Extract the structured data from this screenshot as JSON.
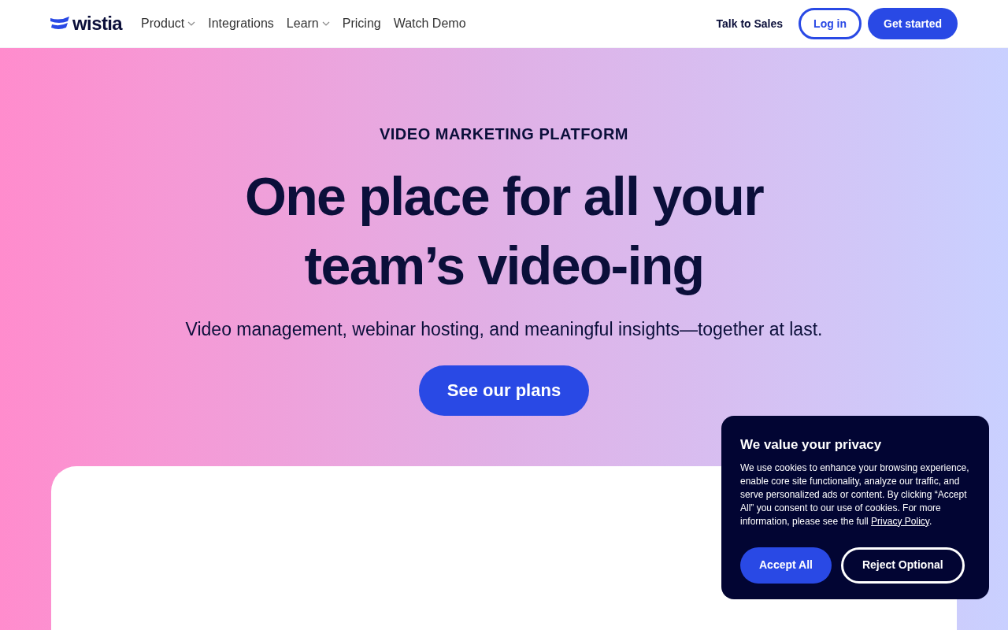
{
  "header": {
    "logo": "wistia",
    "nav": [
      {
        "label": "Product",
        "has_menu": true
      },
      {
        "label": "Integrations",
        "has_menu": false
      },
      {
        "label": "Learn",
        "has_menu": true
      },
      {
        "label": "Pricing",
        "has_menu": false
      },
      {
        "label": "Watch Demo",
        "has_menu": false
      }
    ],
    "talk_to_sales": "Talk to Sales",
    "login": "Log in",
    "get_started": "Get started"
  },
  "hero": {
    "eyebrow": "VIDEO MARKETING PLATFORM",
    "title_lines": [
      "One place for all your",
      "team’s video-ing"
    ],
    "subtitle": "Video management, webinar hosting, and meaningful insights—together at last.",
    "cta": "See our plans"
  },
  "cookie_banner": {
    "title": "We value your privacy",
    "body": "We use cookies to enhance your browsing experience, enable core site functionality, analyze our traffic, and serve personalized ads or content. By clicking “Accept All” you consent to our use of cookies. For more information, please see the full ",
    "link": "Privacy Policy",
    "after_link": ".",
    "accept": "Accept All",
    "reject": "Reject Optional"
  }
}
